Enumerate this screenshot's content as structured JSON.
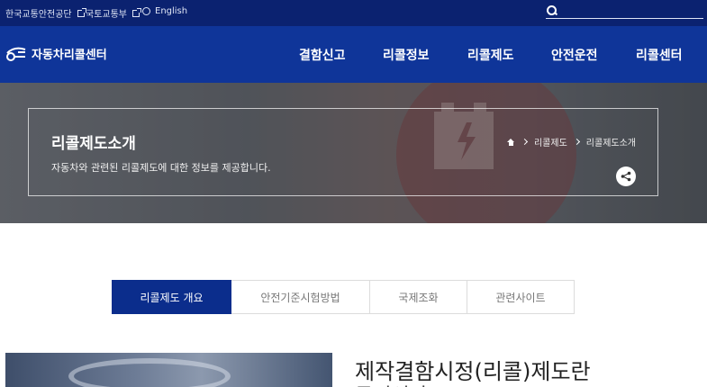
{
  "topbar": {
    "links": [
      {
        "label": "한국교통안전공단"
      },
      {
        "label": "국토교통부"
      },
      {
        "label": "English"
      }
    ],
    "search": {
      "placeholder": ""
    }
  },
  "header": {
    "logo_text": "자동차리콜센터",
    "menu": [
      {
        "label": "결함신고"
      },
      {
        "label": "리콜정보"
      },
      {
        "label": "리콜제도"
      },
      {
        "label": "안전운전"
      },
      {
        "label": "리콜센터"
      }
    ]
  },
  "hero": {
    "title": "리콜제도소개",
    "description": "자동차와 관련된 리콜제도에 대한 정보를 제공합니다.",
    "breadcrumb": [
      "리콜제도",
      "리콜제도소개"
    ]
  },
  "tabs": [
    {
      "label": "리콜제도 개요",
      "active": true
    },
    {
      "label": "안전기준시험방법",
      "active": false
    },
    {
      "label": "국제조화",
      "active": false
    },
    {
      "label": "관련사이트",
      "active": false
    }
  ],
  "content": {
    "title": "제작결함시정(리콜)제도란",
    "subtitle": "무엇인가?"
  },
  "colors": {
    "topbar_bg": "#0b2270",
    "nav_bg": "#0f3599",
    "tab_active_bg": "#0b2d8c"
  }
}
